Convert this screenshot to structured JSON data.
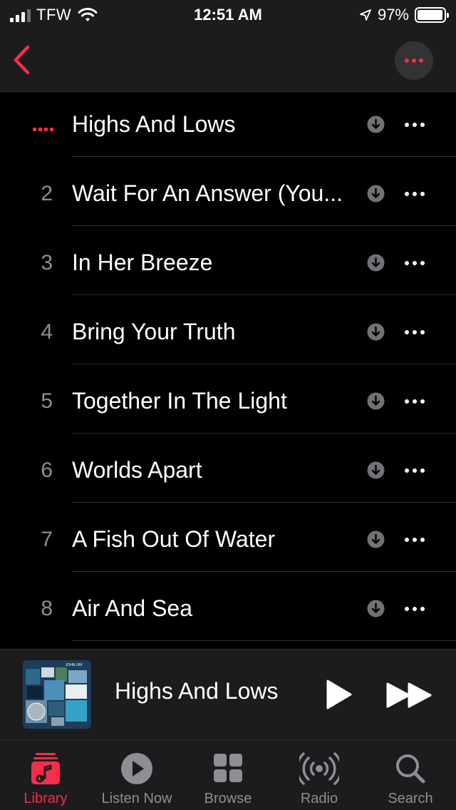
{
  "status_bar": {
    "carrier": "TFW",
    "time": "12:51 AM",
    "battery_percent": "97%",
    "battery_level": 0.97
  },
  "nav": {
    "back_icon": "chevron-left-icon",
    "more_icon": "ellipsis-icon"
  },
  "tracks": [
    {
      "number": "",
      "title": "Highs And Lows",
      "playing": true
    },
    {
      "number": "2",
      "title": "Wait For An Answer (You...",
      "playing": false
    },
    {
      "number": "3",
      "title": "In Her Breeze",
      "playing": false
    },
    {
      "number": "4",
      "title": "Bring Your Truth",
      "playing": false
    },
    {
      "number": "5",
      "title": "Together In The Light",
      "playing": false
    },
    {
      "number": "6",
      "title": "Worlds Apart",
      "playing": false
    },
    {
      "number": "7",
      "title": "A Fish Out Of Water",
      "playing": false
    },
    {
      "number": "8",
      "title": "Air And Sea",
      "playing": false
    }
  ],
  "mini_player": {
    "title": "Highs And Lows",
    "artwork_text": "JOHN ZAY"
  },
  "tabs": [
    {
      "label": "Library",
      "icon": "library-icon",
      "active": true
    },
    {
      "label": "Listen Now",
      "icon": "play-circle-icon",
      "active": false
    },
    {
      "label": "Browse",
      "icon": "grid-icon",
      "active": false
    },
    {
      "label": "Radio",
      "icon": "radio-icon",
      "active": false
    },
    {
      "label": "Search",
      "icon": "search-icon",
      "active": false
    }
  ],
  "colors": {
    "accent": "#fa2d48",
    "background": "#000000",
    "bar_background": "#1c1c1e",
    "secondary_text": "#8e8e93"
  }
}
